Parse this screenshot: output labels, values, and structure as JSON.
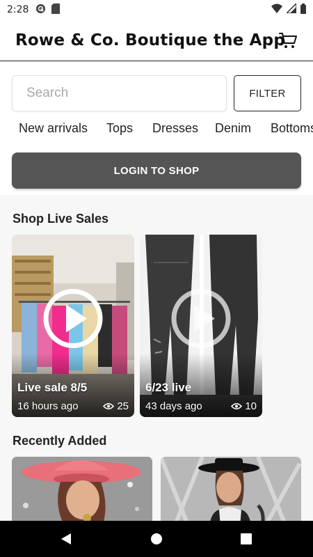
{
  "status_bar": {
    "time": "2:28"
  },
  "header": {
    "title": "Rowe & Co. Boutique the App"
  },
  "search": {
    "placeholder": "Search",
    "value": ""
  },
  "filter": {
    "label": "FILTER"
  },
  "categories": [
    "New arrivals",
    "Tops",
    "Dresses",
    "Denim",
    "Bottoms"
  ],
  "login": {
    "label": "LOGIN TO SHOP"
  },
  "live_section": {
    "title": "Shop Live Sales",
    "cards": [
      {
        "title": "Live sale 8/5",
        "ago": "16 hours ago",
        "views": "25"
      },
      {
        "title": "6/23 live",
        "ago": "43 days ago",
        "views": "10"
      }
    ]
  },
  "recent_section": {
    "title": "Recently Added"
  },
  "colors": {
    "login_bg": "#555555",
    "content_bg": "#f7f7f7",
    "nav_bg": "#000000"
  }
}
